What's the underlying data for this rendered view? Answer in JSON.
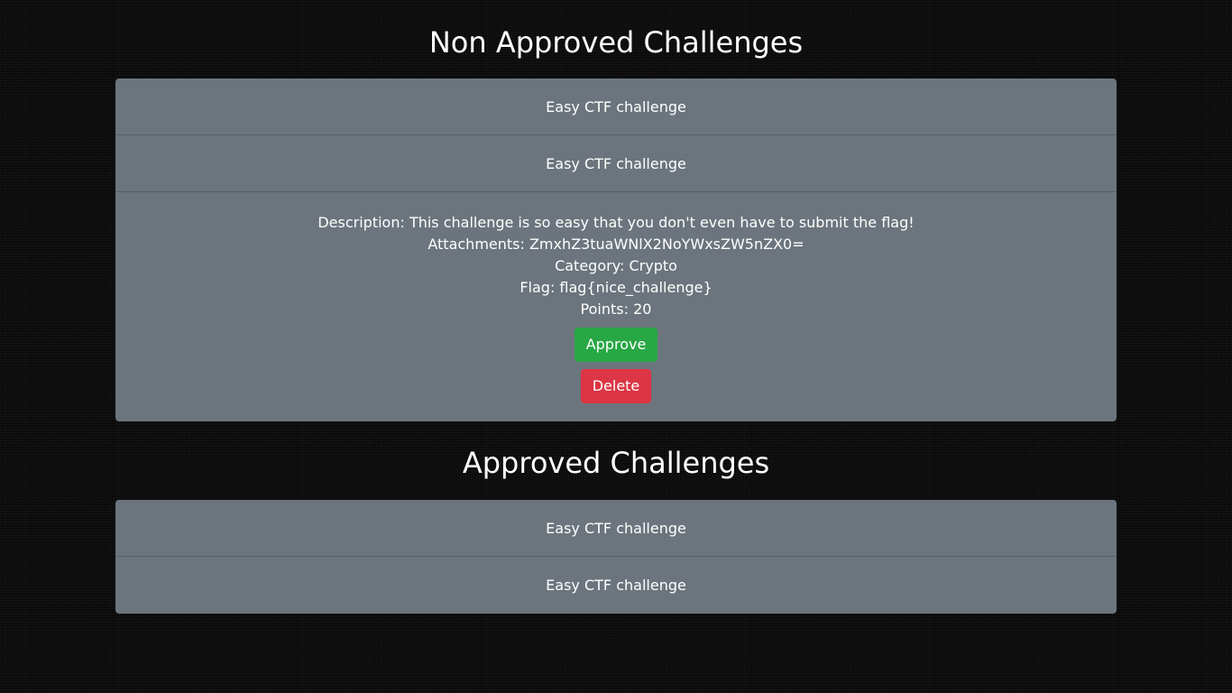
{
  "sections": {
    "non_approved_title": "Non Approved Challenges",
    "approved_title": "Approved Challenges"
  },
  "non_approved": {
    "items": [
      {
        "title": "Easy CTF challenge"
      },
      {
        "title": "Easy CTF challenge"
      }
    ],
    "expanded": {
      "description": "Description: This challenge is so easy that you don't even have to submit the flag!",
      "attachments": "Attachments: ZmxhZ3tuaWNlX2NoYWxsZW5nZX0=",
      "category": "Category: Crypto",
      "flag": "Flag: flag{nice_challenge}",
      "points": "Points: 20",
      "approve_label": "Approve",
      "delete_label": "Delete"
    }
  },
  "approved": {
    "items": [
      {
        "title": "Easy CTF challenge"
      },
      {
        "title": "Easy CTF challenge"
      }
    ]
  },
  "colors": {
    "panel": "#6c757d",
    "approve": "#28a745",
    "delete": "#dc3545",
    "background": "#0b0b0b"
  }
}
